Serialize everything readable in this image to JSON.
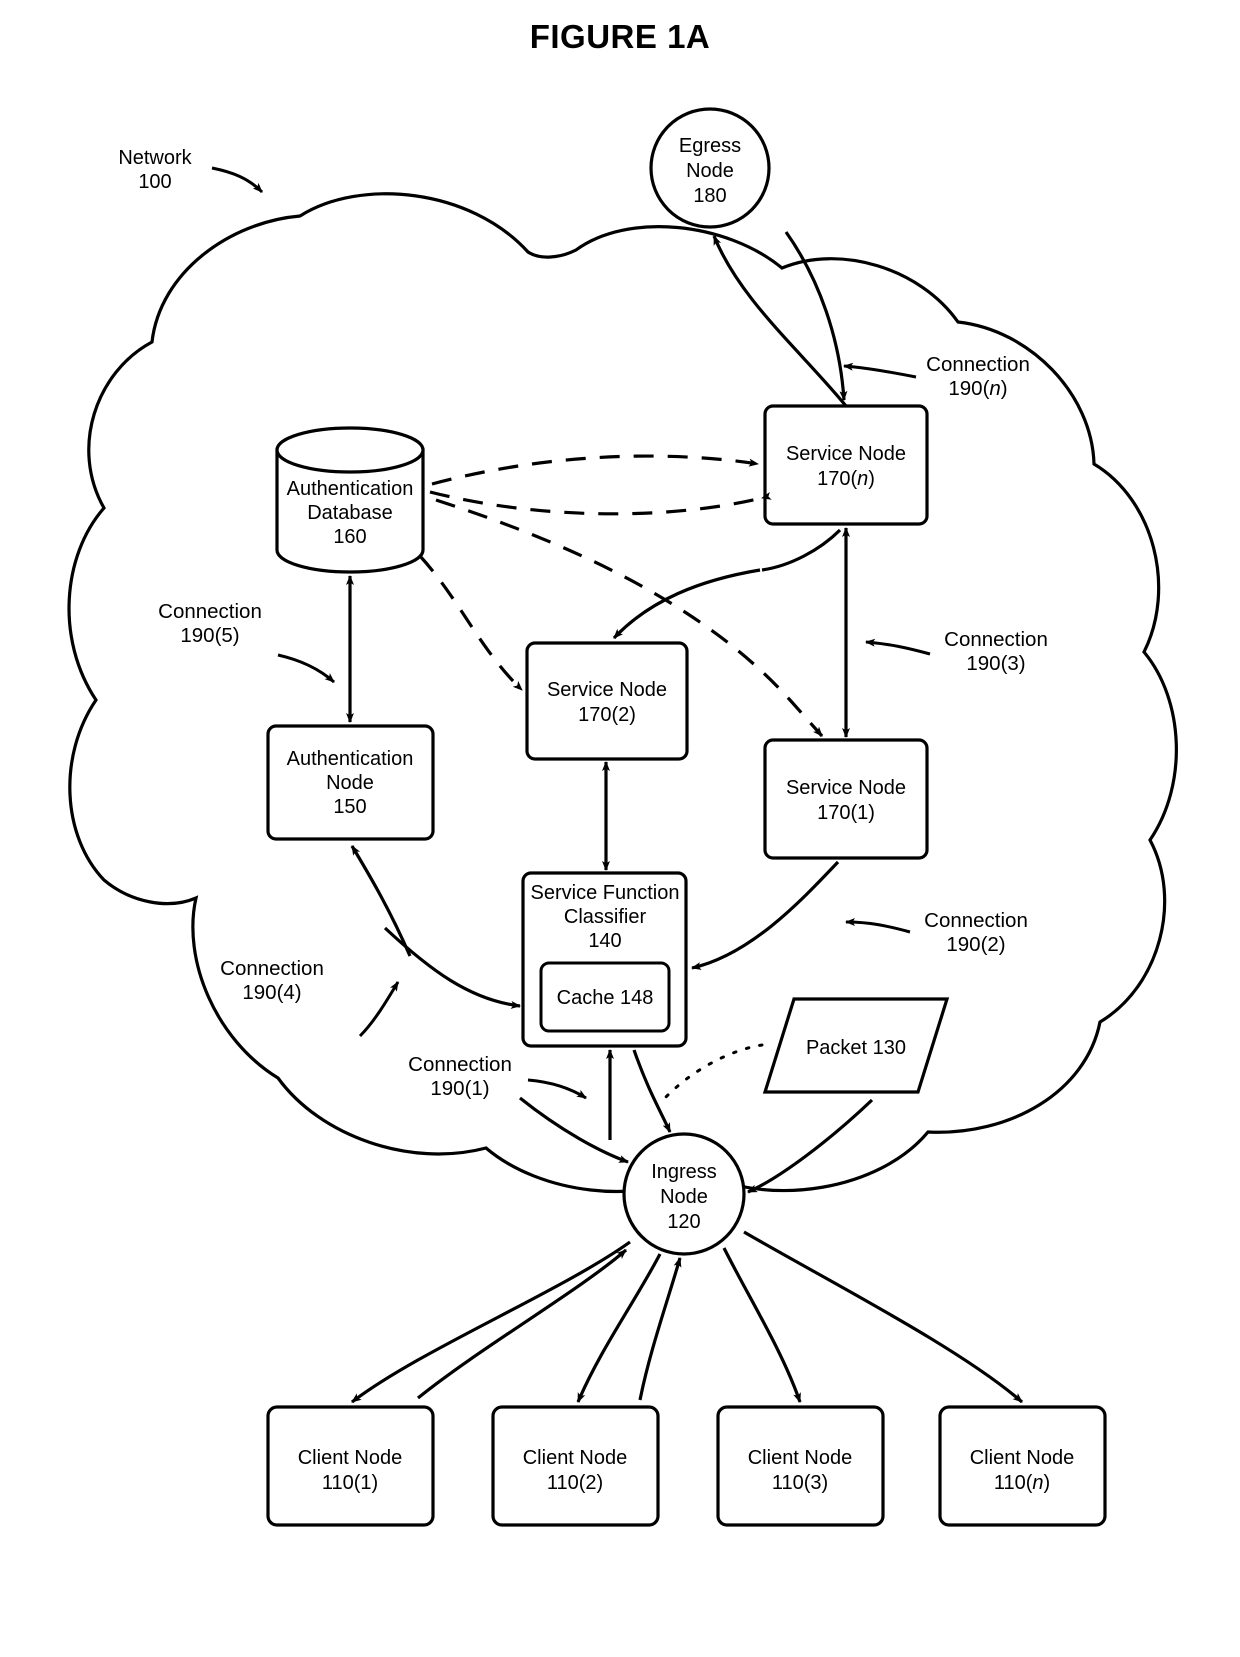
{
  "figure": {
    "title": "FIGURE 1A"
  },
  "network": {
    "label_line1": "Network",
    "label_line2": "100"
  },
  "nodes": {
    "egress": {
      "line1": "Egress",
      "line2": "Node",
      "line3": "180"
    },
    "ingress": {
      "line1": "Ingress",
      "line2": "Node",
      "line3": "120"
    },
    "auth_db": {
      "line1": "Authentication",
      "line2": "Database",
      "line3": "160"
    },
    "auth_node": {
      "line1": "Authentication",
      "line2": "Node",
      "line3": "150"
    },
    "classifier": {
      "line1": "Service Function",
      "line2": "Classifier",
      "line3": "140"
    },
    "cache": {
      "line1": "Cache 148"
    },
    "packet": {
      "line1": "Packet 130"
    },
    "service_n": {
      "line1": "Service Node",
      "line2_prefix": "170(",
      "line2_italic": "n",
      "line2_suffix": ")"
    },
    "service_2": {
      "line1": "Service Node",
      "line2": "170(2)"
    },
    "service_1": {
      "line1": "Service Node",
      "line2": "170(1)"
    }
  },
  "clients": [
    {
      "line1": "Client Node",
      "line2": "110(1)",
      "italic": ""
    },
    {
      "line1": "Client Node",
      "line2": "110(2)",
      "italic": ""
    },
    {
      "line1": "Client Node",
      "line2": "110(3)",
      "italic": ""
    },
    {
      "line1": "Client Node",
      "line2_prefix": "110(",
      "line2_italic": "n",
      "line2_suffix": ")"
    }
  ],
  "connections": [
    {
      "id": "190n",
      "line1": "Connection",
      "prefix": "190(",
      "italic": "n",
      "suffix": ")"
    },
    {
      "id": "190_5",
      "line1": "Connection",
      "line2": "190(5)"
    },
    {
      "id": "190_3",
      "line1": "Connection",
      "line2": "190(3)"
    },
    {
      "id": "190_4",
      "line1": "Connection",
      "line2": "190(4)"
    },
    {
      "id": "190_2",
      "line1": "Connection",
      "line2": "190(2)"
    },
    {
      "id": "190_1",
      "line1": "Connection",
      "line2": "190(1)"
    }
  ],
  "style": {
    "stroke": "#000000",
    "fill": "#ffffff",
    "background": "#ffffff"
  }
}
